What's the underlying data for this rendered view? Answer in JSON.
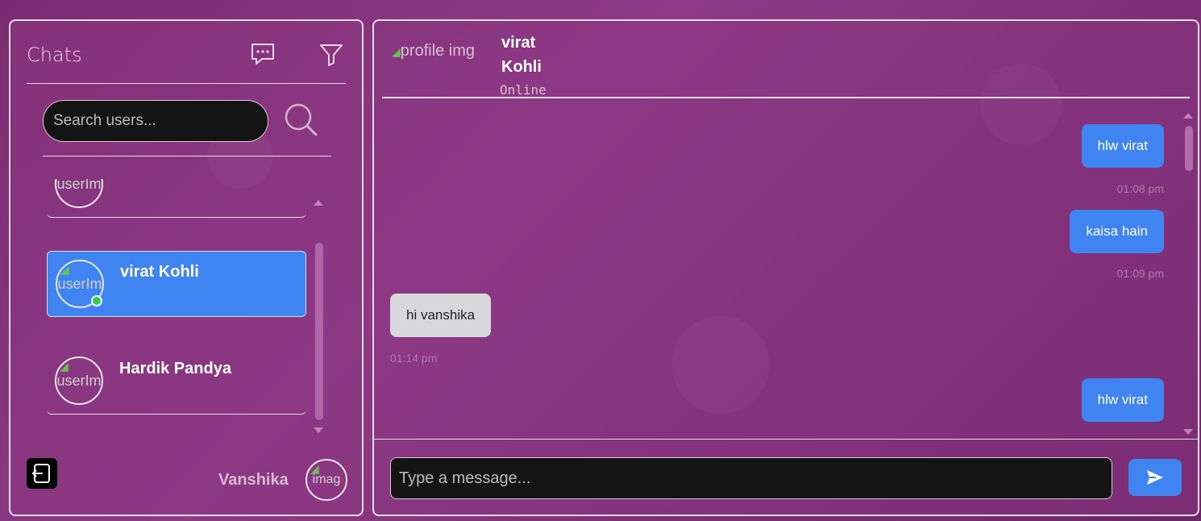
{
  "sidebar": {
    "title": "Chats",
    "search": {
      "placeholder": "Search users...",
      "value": ""
    },
    "users": [
      {
        "name": "",
        "avatar_alt": "userIm",
        "online": false
      },
      {
        "name": "virat Kohli",
        "avatar_alt": "userIm",
        "online": true,
        "active": true
      },
      {
        "name": "Hardik Pandya",
        "avatar_alt": "userIm",
        "online": false
      }
    ],
    "current_user": {
      "name": "Vanshika",
      "avatar_alt": "imag"
    }
  },
  "chat": {
    "header": {
      "avatar_alt": "profile img",
      "first_name": "virat",
      "last_name": "Kohli",
      "status": "Online"
    },
    "messages": [
      {
        "text": "hlw virat",
        "time": "01:08 pm",
        "direction": "sent"
      },
      {
        "text": "kaisa hain",
        "time": "01:09 pm",
        "direction": "sent"
      },
      {
        "text": "hi vanshika",
        "time": "01:14 pm",
        "direction": "received"
      },
      {
        "text": "hlw virat",
        "time": "",
        "direction": "sent"
      }
    ],
    "composer": {
      "placeholder": "Type a message...",
      "value": ""
    }
  },
  "icons": [
    "chat-bubble-icon",
    "filter-icon",
    "search-icon",
    "logout-icon",
    "send-icon"
  ],
  "colors": {
    "accent": "#3f84f0",
    "online": "#2ecc55",
    "background": "#8e3a86"
  }
}
